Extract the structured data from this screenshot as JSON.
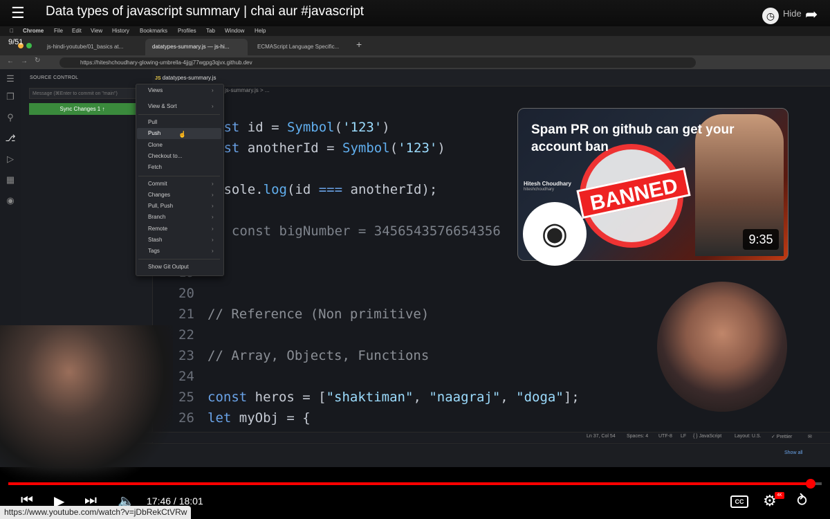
{
  "youtube": {
    "video_title": "Data types of javascript summary | chai aur #javascript",
    "playlist_counter": "9/51",
    "hide_label": "Hide",
    "time": "17:46 / 18:01",
    "progress": 0.9861,
    "cc_label": "CC",
    "quality_badge": "4K",
    "status_url": "https://www.youtube.com/watch?v=jDbRekCtVRw"
  },
  "mac_menu": [
    "Chrome",
    "File",
    "Edit",
    "View",
    "History",
    "Bookmarks",
    "Profiles",
    "Tab",
    "Window",
    "Help"
  ],
  "browser": {
    "tabs": [
      "js-hindi-youtube/01_basics at...",
      "datatypes-summary.js — js-hi...",
      "ECMAScript Language Specific..."
    ],
    "url": "https://hiteshchoudhary-glowing-umbrella-4jjgj77wgpg3qjvx.github.dev"
  },
  "vscode": {
    "source_control_title": "SOURCE CONTROL",
    "commit_placeholder": "Message (⌘Enter to commit on \"main\")",
    "sync_button": "Sync Changes 1 ↑",
    "editor_tab": "datatypes-summary.js",
    "breadcrumb": "js-summary.js > ...",
    "context_menu": {
      "group1": [
        "Views",
        "View & Sort"
      ],
      "group2": [
        "Pull",
        "Push",
        "Clone",
        "Checkout to...",
        "Fetch"
      ],
      "group3": [
        "Commit",
        "Changes",
        "Pull, Push",
        "Branch",
        "Remote",
        "Stash",
        "Tags"
      ],
      "group4": [
        "Show Git Output"
      ]
    },
    "code_lines": [
      {
        "ln": "",
        "text": "nst id = Symbol('123')"
      },
      {
        "ln": "",
        "text": "nst anotherId = Symbol('123')"
      },
      {
        "ln": "",
        "text": "nsole.log(id === anotherId);"
      },
      {
        "ln": "",
        "text": "  const bigNumber = 3456543576654356"
      },
      {
        "ln": "19",
        "text": ""
      },
      {
        "ln": "20",
        "text": ""
      },
      {
        "ln": "21",
        "text": "// Reference (Non primitive)"
      },
      {
        "ln": "22",
        "text": ""
      },
      {
        "ln": "23",
        "text": "// Array, Objects, Functions"
      },
      {
        "ln": "24",
        "text": ""
      },
      {
        "ln": "25",
        "text": "const heros = [\"shaktiman\", \"naagraj\", \"doga\"];"
      },
      {
        "ln": "26",
        "text": "let myObj = {"
      }
    ],
    "status": {
      "position": "Ln 37, Col 54",
      "spaces": "Spaces: 4",
      "encoding": "UTF-8",
      "eol": "LF",
      "language": "{ } JavaScript",
      "layout": "Layout: U.S.",
      "prettier": "✓ Prettier"
    },
    "show_all": "Show all"
  },
  "thumbnail": {
    "title": "Spam PR on github can get your account ban",
    "stamp": "BANNED",
    "profile_name": "Hitesh Choudhary",
    "profile_handle": "hiteshchoudhary",
    "duration": "9:35"
  }
}
